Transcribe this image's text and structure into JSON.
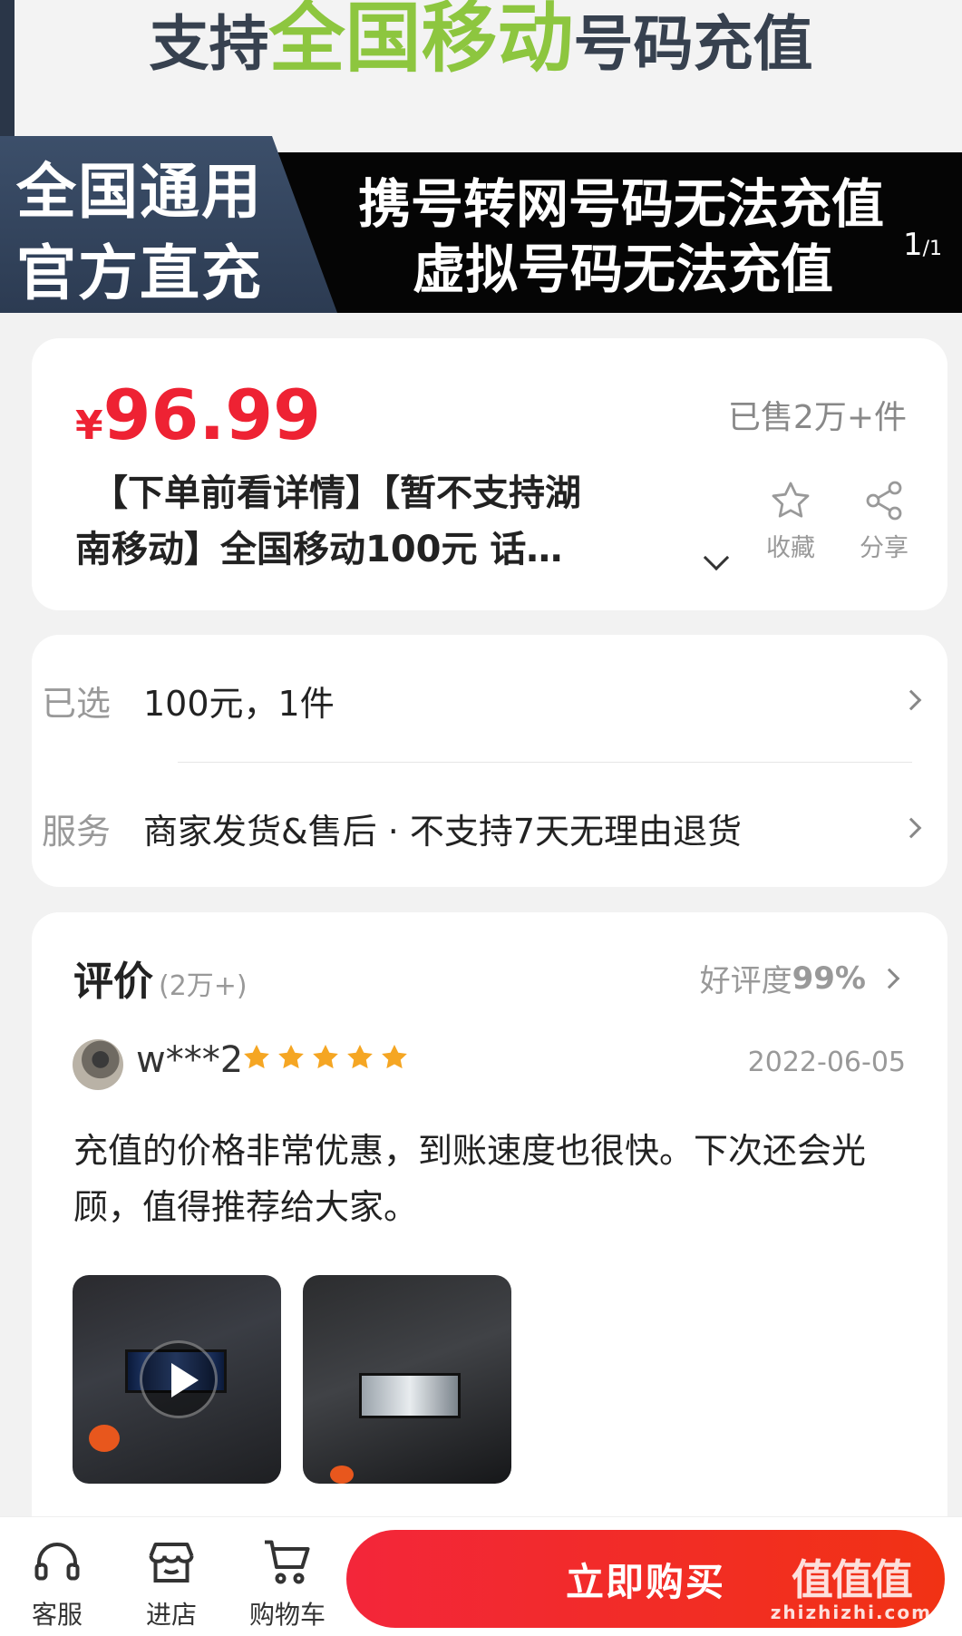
{
  "banner": {
    "top_prefix": "支持",
    "top_highlight": "全国移动",
    "top_suffix": "号码充值",
    "blue_line1": "全国通用",
    "blue_line2": "官方直充",
    "black_line1": "携号转网号码无法充值",
    "black_line2": "虚拟号码无法充值",
    "page_current": "1",
    "page_total": "/1"
  },
  "product": {
    "currency": "¥",
    "price": "96.99",
    "sold": "已售2万+件",
    "title_line1": "【下单前看详情】【暂不支持湖",
    "title_line2": "南移动】全国移动100元 话费充…",
    "favorite_label": "收藏",
    "share_label": "分享"
  },
  "selection": {
    "selected_label": "已选",
    "selected_value": "100元，1件",
    "service_label": "服务",
    "service_value": "商家发货&售后 · 不支持7天无理由退货"
  },
  "reviews": {
    "heading": "评价",
    "count": "(2万+)",
    "good_rate_label": "好评度",
    "good_rate_value": "99%",
    "item": {
      "username": "w***2",
      "rating": 5,
      "date": "2022-06-05",
      "text": "充值的价格非常优惠，到账速度也很快。下次还会光顾，值得推荐给大家。"
    }
  },
  "bottom_bar": {
    "service_label": "客服",
    "store_label": "进店",
    "cart_label": "购物车",
    "buy_label": "立即购买"
  },
  "watermark": {
    "logo_text": "值值值",
    "site": "zhizhizhi.com"
  },
  "colors": {
    "price_red": "#ee2233",
    "buy_button": "#f3263a",
    "star": "#f5a623",
    "banner_green": "#8dc63f"
  },
  "icons": [
    "star-outline-icon",
    "share-icon",
    "headset-icon",
    "store-icon",
    "cart-icon",
    "play-icon",
    "star-icon",
    "chevron-right-icon",
    "chevron-down-icon"
  ]
}
